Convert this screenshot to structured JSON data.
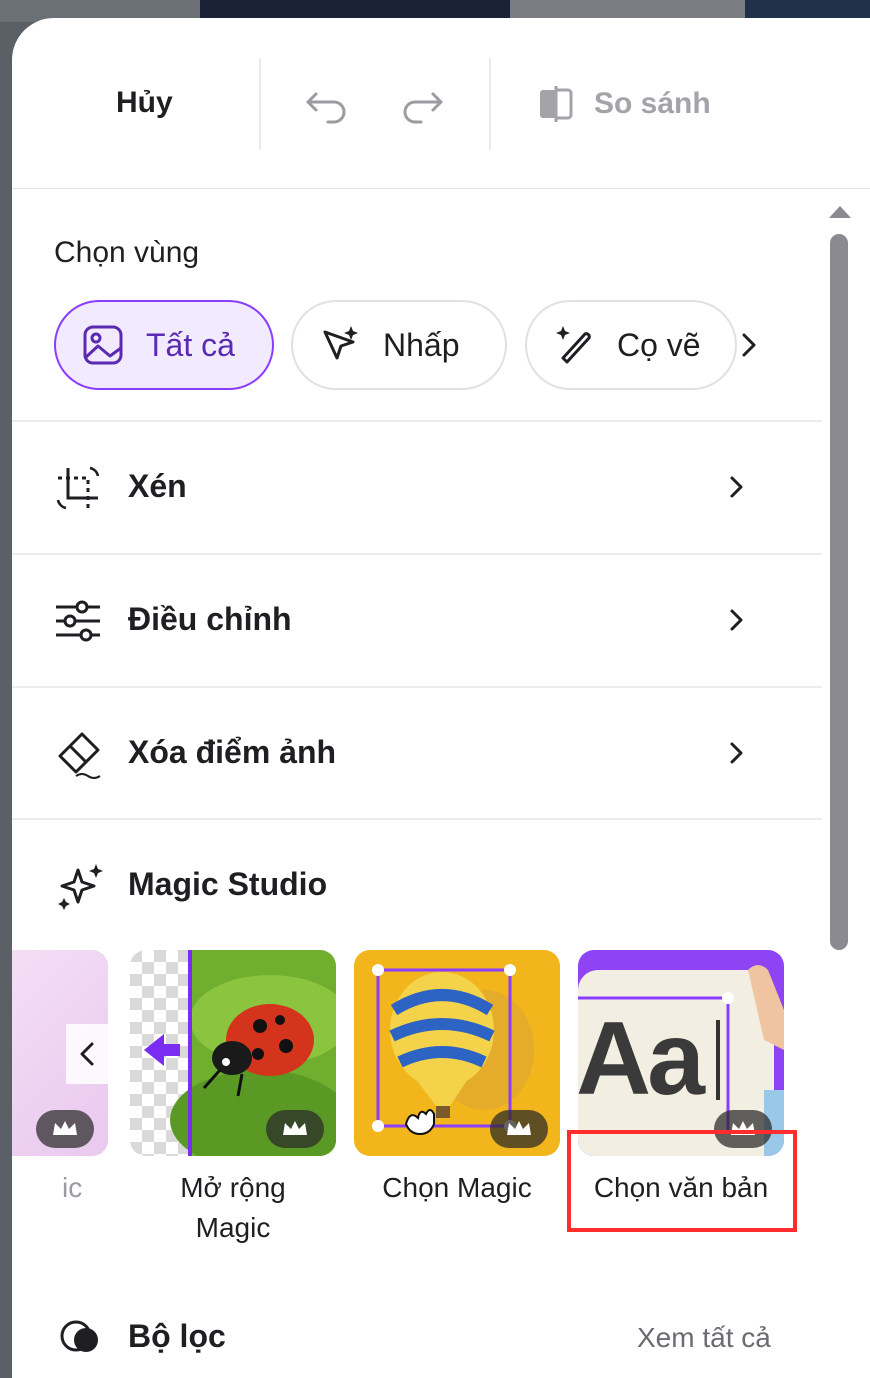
{
  "toolbar": {
    "cancel_label": "Hủy",
    "compare_label": "So sánh"
  },
  "select_region": {
    "title": "Chọn vùng",
    "chips": [
      {
        "label": "Tất cả",
        "icon": "image-icon",
        "active": true
      },
      {
        "label": "Nhấp",
        "icon": "sparkle-cursor-icon",
        "active": false
      },
      {
        "label": "Cọ vẽ",
        "icon": "magic-brush-icon",
        "active": false
      }
    ]
  },
  "menu": {
    "items": [
      {
        "label": "Xén",
        "icon": "crop-icon"
      },
      {
        "label": "Điều chỉnh",
        "icon": "sliders-icon"
      },
      {
        "label": "Xóa điểm ảnh",
        "icon": "eraser-icon"
      }
    ]
  },
  "magic_studio": {
    "title": "Magic Studio",
    "partial_tile_caption": "ic",
    "tiles": [
      {
        "caption_line1": "Mở rộng",
        "caption_line2": "Magic",
        "premium": true
      },
      {
        "caption_line1": "Chọn Magic",
        "caption_line2": "",
        "premium": true
      },
      {
        "caption_line1": "Chọn văn bản",
        "caption_line2": "",
        "premium": true,
        "tile_text": "Aa"
      }
    ]
  },
  "filters": {
    "title": "Bộ lọc",
    "see_all": "Xem tất cả"
  },
  "colors": {
    "accent": "#8b3dff",
    "highlight": "#ff2d2d"
  }
}
